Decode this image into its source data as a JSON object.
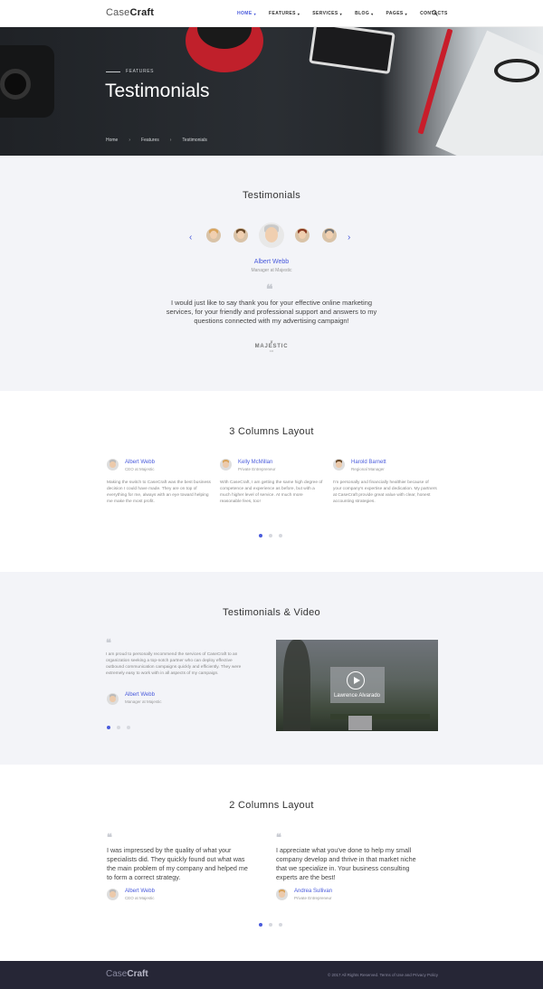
{
  "header": {
    "logo_light": "Case",
    "logo_bold": "Craft",
    "nav": [
      {
        "label": "HOME",
        "active": true,
        "has_caret": true
      },
      {
        "label": "FEATURES",
        "active": false,
        "has_caret": true
      },
      {
        "label": "SERVICES",
        "active": false,
        "has_caret": true
      },
      {
        "label": "BLOG",
        "active": false,
        "has_caret": true
      },
      {
        "label": "PAGES",
        "active": false,
        "has_caret": true
      },
      {
        "label": "CONTACTS",
        "active": false,
        "has_caret": false
      }
    ],
    "search_icon": "search-icon"
  },
  "hero": {
    "eyebrow": "FEATURES",
    "title": "Testimonials",
    "breadcrumb": [
      "Home",
      "Features",
      "Testimonials"
    ],
    "breadcrumb_separator": "›"
  },
  "section_testimonials": {
    "title": "Testimonials",
    "featured": {
      "name": "Albert Webb",
      "role": "Manager at Majestic",
      "quote": "I would just like to say thank you for your effective online marketing services, for your friendly and professional support and answers to my questions connected with my advertising campaign!",
      "logo_word": "MAJESTIC",
      "logo_sub": "CO"
    },
    "prev_icon": "chevron-left-icon",
    "next_icon": "chevron-right-icon"
  },
  "section_3col": {
    "title": "3 Columns Layout",
    "items": [
      {
        "name": "Albert Webb",
        "role": "CEO at Majestic",
        "text": "Making the switch to CaseCraft was the best business decision I could have made. They are on top of everything for me, always with an eye toward helping me make the most profit."
      },
      {
        "name": "Kelly McMillan",
        "role": "Private Entrepreneur",
        "text": "With CaseCraft, I am getting the same high degree of competence and experience as before, but with a much higher level of service. At much more reasonable fees, too!"
      },
      {
        "name": "Harold Barnett",
        "role": "Regional Manager",
        "text": "I'm personally and financially healthier because of your company's expertise and dedication. My partners at CaseCraft provide great value with clear, honest accounting strategies."
      }
    ]
  },
  "section_video": {
    "title": "Testimonials & Video",
    "quote": "I am proud to personally recommend the services of CaseCraft to an organization seeking a top-notch partner who can deploy effective outbound communication campaigns quickly and efficiently. They were extremely easy to work with in all aspects of my campaign.",
    "name": "Albert Webb",
    "role": "Manager at Majestic",
    "video_caption": "Lawrence Alvarado",
    "play_icon": "play-icon"
  },
  "section_2col": {
    "title": "2 Columns Layout",
    "items": [
      {
        "name": "Albert Webb",
        "role": "CEO at Majestic",
        "text": "I was impressed by the quality of what your specialists did. They quickly found out what was the main problem of my company and helped me to form a correct strategy."
      },
      {
        "name": "Andrea Sullivan",
        "role": "Private Entrepreneur",
        "text": "I appreciate what you've done to help my small company develop and thrive in that market niche that we specialize in. Your business consulting experts are the best!"
      }
    ]
  },
  "footer": {
    "logo_light": "Case",
    "logo_bold": "Craft",
    "copyright": "© 2017 All Rights Reserved. Terms of Use and Privacy Policy"
  },
  "colors": {
    "accent": "#4a5bdc",
    "footer_bg": "#262636",
    "section_gray": "#f3f4f8"
  }
}
